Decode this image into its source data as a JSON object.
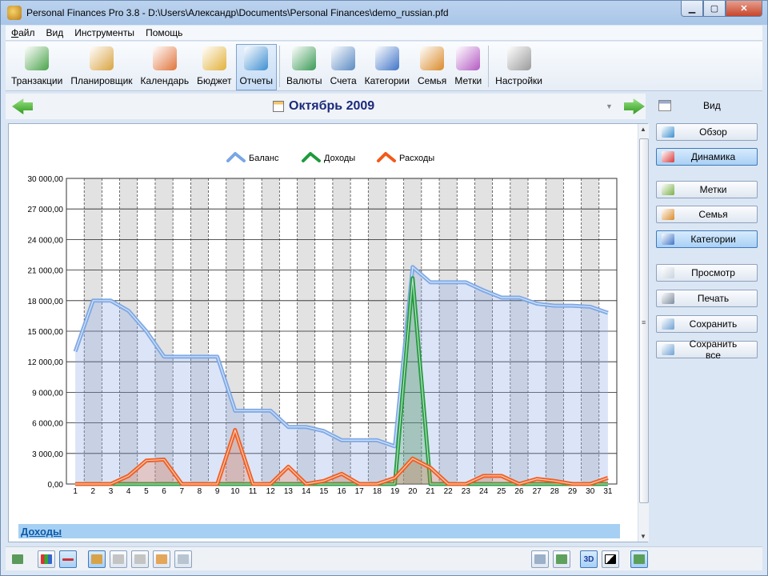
{
  "window": {
    "title": "Personal Finances Pro 3.8 - D:\\Users\\Александр\\Documents\\Personal Finances\\demo_russian.pfd"
  },
  "menu": [
    {
      "first": "Ф",
      "rest": "айл"
    },
    {
      "first": "",
      "rest": "Вид"
    },
    {
      "first": "",
      "rest": "Инструменты"
    },
    {
      "first": "",
      "rest": "Помощь"
    }
  ],
  "toolbar": {
    "items": [
      {
        "label": "Транзакции",
        "icon": "transactions-icon",
        "color": "#4aa34a"
      },
      {
        "label": "Планировщик",
        "icon": "planner-icon",
        "color": "#d9a441"
      },
      {
        "label": "Календарь",
        "icon": "calendar-icon",
        "color": "#e0743a"
      },
      {
        "label": "Бюджет",
        "icon": "budget-icon",
        "color": "#e2b13a"
      },
      {
        "label": "Отчеты",
        "icon": "reports-icon",
        "color": "#3e8fd1"
      },
      {
        "label": "Валюты",
        "icon": "currencies-icon",
        "color": "#3a9a55"
      },
      {
        "label": "Счета",
        "icon": "accounts-icon",
        "color": "#5a8ac2"
      },
      {
        "label": "Категории",
        "icon": "categories-icon",
        "color": "#3f74c7"
      },
      {
        "label": "Семья",
        "icon": "family-icon",
        "color": "#d98b2a"
      },
      {
        "label": "Метки",
        "icon": "tags-icon",
        "color": "#b35ac2"
      },
      {
        "label": "Настройки",
        "icon": "settings-icon",
        "color": "#9a9a9a"
      }
    ],
    "active": "Отчеты"
  },
  "nav": {
    "period": "Октябрь 2009"
  },
  "sidebar": {
    "header": "Вид",
    "buttons": [
      {
        "label": "Обзор",
        "icon": "pie-icon",
        "color": "#3b8fd0"
      },
      {
        "label": "Динамика",
        "icon": "dynamics-icon",
        "color": "#d93a3a"
      },
      {
        "label": "Метки",
        "icon": "tags-icon",
        "color": "#7bb04a"
      },
      {
        "label": "Семья",
        "icon": "family-icon",
        "color": "#d98b2a"
      },
      {
        "label": "Категории",
        "icon": "categories-icon",
        "color": "#3f74c7"
      },
      {
        "label": "Просмотр",
        "icon": "preview-icon",
        "color": "#c9d3df"
      },
      {
        "label": "Печать",
        "icon": "print-icon",
        "color": "#7e8c9d"
      },
      {
        "label": "Сохранить",
        "icon": "save-icon",
        "color": "#6fa1d4"
      },
      {
        "label": "Сохранить все",
        "icon": "save-all-icon",
        "color": "#6fa1d4"
      }
    ],
    "active": [
      "Динамика",
      "Категории"
    ]
  },
  "panel": {
    "section_label": "Доходы"
  },
  "status": {
    "three_d_label": "3D"
  },
  "colors": {
    "balance": "#7aa6e6",
    "income": "#1f9a3a",
    "expense": "#f25a1a"
  },
  "chart_data": {
    "type": "area",
    "x": [
      1,
      2,
      3,
      4,
      5,
      6,
      7,
      8,
      9,
      10,
      11,
      12,
      13,
      14,
      15,
      16,
      17,
      18,
      19,
      20,
      21,
      22,
      23,
      24,
      25,
      26,
      27,
      28,
      29,
      30,
      31
    ],
    "ylim": [
      0,
      30000
    ],
    "yticks": [
      "0,00",
      "3 000,00",
      "6 000,00",
      "9 000,00",
      "12 000,00",
      "15 000,00",
      "18 000,00",
      "21 000,00",
      "24 000,00",
      "27 000,00",
      "30 000,00"
    ],
    "series": [
      {
        "name": "Баланс",
        "values": [
          13000,
          18000,
          18000,
          17000,
          15000,
          12500,
          12500,
          12500,
          12500,
          7200,
          7200,
          7200,
          5600,
          5600,
          5200,
          4300,
          4300,
          4300,
          3700,
          21300,
          19800,
          19800,
          19800,
          19000,
          18300,
          18300,
          17700,
          17500,
          17500,
          17400,
          16800
        ]
      },
      {
        "name": "Доходы",
        "values": [
          0,
          0,
          0,
          0,
          0,
          0,
          0,
          0,
          0,
          0,
          0,
          0,
          0,
          0,
          0,
          0,
          0,
          0,
          0,
          20200,
          0,
          0,
          0,
          0,
          0,
          0,
          0,
          0,
          0,
          0,
          0
        ]
      },
      {
        "name": "Расходы",
        "values": [
          0,
          0,
          0,
          800,
          2300,
          2400,
          0,
          0,
          0,
          5300,
          0,
          0,
          1700,
          0,
          300,
          1000,
          0,
          0,
          600,
          2500,
          1600,
          0,
          0,
          800,
          800,
          0,
          500,
          300,
          0,
          0,
          600
        ]
      }
    ],
    "legend": "top-center",
    "grid": true
  }
}
